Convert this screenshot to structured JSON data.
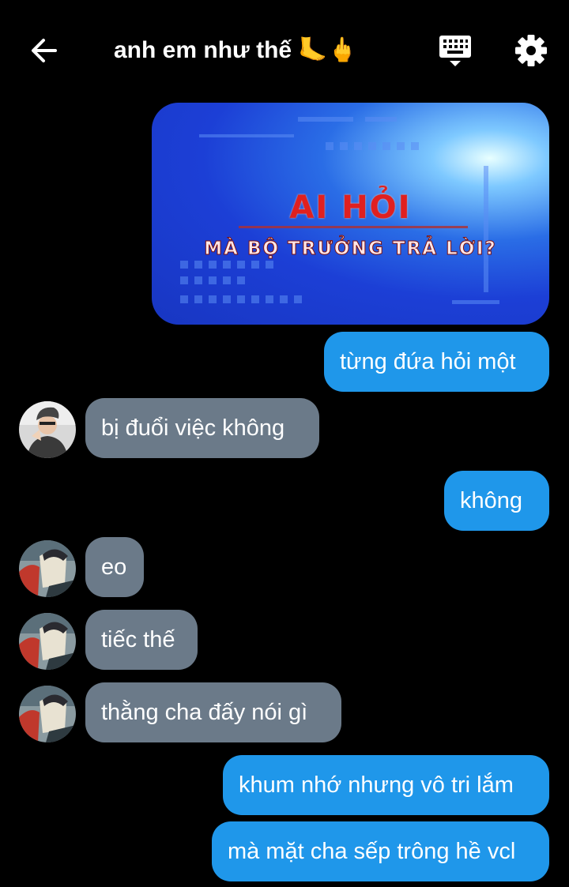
{
  "header": {
    "title": "anh em như thế 🦶🖕",
    "back_icon": "arrow-left-icon",
    "keyboard_icon": "keyboard-icon",
    "settings_icon": "gear-icon"
  },
  "image_message": {
    "headline": "AI HỎI",
    "subline": "MÀ BỘ TRƯỞNG TRẢ LỜI?"
  },
  "messages": [
    {
      "direction": "out",
      "text": "từng đứa hỏi một"
    },
    {
      "direction": "in",
      "text": "bị đuổi việc không"
    },
    {
      "direction": "out",
      "text": "không"
    },
    {
      "direction": "in",
      "text": "eo"
    },
    {
      "direction": "in",
      "text": "tiếc thế"
    },
    {
      "direction": "in",
      "text": "thằng cha đấy nói gì"
    },
    {
      "direction": "out",
      "text": "khum nhớ nhưng vô tri lắm"
    },
    {
      "direction": "out",
      "text": "mà mặt cha sếp trông hề vcl"
    }
  ],
  "colors": {
    "background": "#000000",
    "outgoing_bubble": "#1f97ea",
    "incoming_bubble": "#6b7a89",
    "text": "#ffffff"
  }
}
